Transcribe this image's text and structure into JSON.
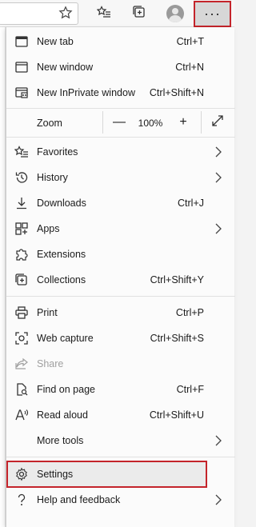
{
  "toolbar": {
    "icons": [
      "favorite-star-icon",
      "favorites-icon",
      "collections-icon",
      "profile-avatar-icon"
    ],
    "more_label": "···"
  },
  "menu": {
    "new_tab": {
      "label": "New tab",
      "shortcut": "Ctrl+T"
    },
    "new_window": {
      "label": "New window",
      "shortcut": "Ctrl+N"
    },
    "new_inprivate": {
      "label": "New InPrivate window",
      "shortcut": "Ctrl+Shift+N"
    },
    "zoom": {
      "label": "Zoom",
      "value": "100%",
      "minus": "—",
      "plus": "+"
    },
    "favorites": {
      "label": "Favorites"
    },
    "history": {
      "label": "History"
    },
    "downloads": {
      "label": "Downloads",
      "shortcut": "Ctrl+J"
    },
    "apps": {
      "label": "Apps"
    },
    "extensions": {
      "label": "Extensions"
    },
    "collections": {
      "label": "Collections",
      "shortcut": "Ctrl+Shift+Y"
    },
    "print": {
      "label": "Print",
      "shortcut": "Ctrl+P"
    },
    "web_capture": {
      "label": "Web capture",
      "shortcut": "Ctrl+Shift+S"
    },
    "share": {
      "label": "Share"
    },
    "find_on_page": {
      "label": "Find on page",
      "shortcut": "Ctrl+F"
    },
    "read_aloud": {
      "label": "Read aloud",
      "shortcut": "Ctrl+Shift+U"
    },
    "more_tools": {
      "label": "More tools"
    },
    "settings": {
      "label": "Settings"
    },
    "help_feedback": {
      "label": "Help and feedback"
    }
  },
  "colors": {
    "highlight": "#c4242b",
    "disabled": "#a0a0a0"
  }
}
